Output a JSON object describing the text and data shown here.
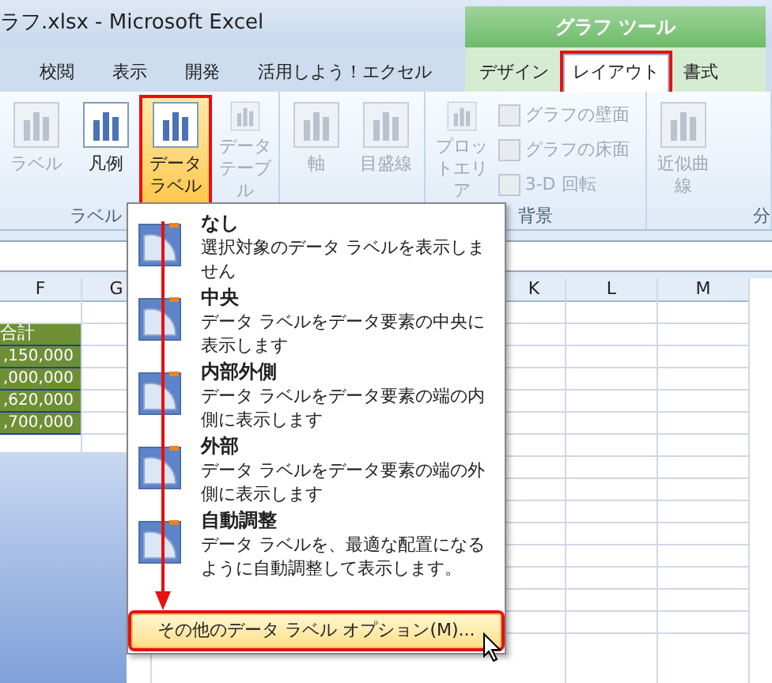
{
  "window": {
    "title": "ラフ.xlsx - Microsoft Excel",
    "context_group": "グラフ ツール"
  },
  "tabs": [
    {
      "label": "校閲",
      "selected": false
    },
    {
      "label": "表示",
      "selected": false
    },
    {
      "label": "開発",
      "selected": false
    },
    {
      "label": "活用しよう！エクセル",
      "selected": false
    }
  ],
  "context_tabs": [
    {
      "label": "デザイン",
      "selected": false
    },
    {
      "label": "レイアウト",
      "selected": true,
      "marked": true
    },
    {
      "label": "書式",
      "selected": false
    }
  ],
  "ribbon": {
    "groups": [
      {
        "label": "ラベル",
        "buttons": [
          {
            "kind": "large",
            "label": "ラベル",
            "disabled": true,
            "selected": false
          },
          {
            "kind": "large",
            "label": "凡例",
            "disabled": false,
            "selected": false
          },
          {
            "kind": "large",
            "label": "データラベル",
            "disabled": false,
            "selected": true,
            "marked": true
          },
          {
            "kind": "large",
            "label": "データテーブル",
            "disabled": true,
            "selected": false
          }
        ]
      },
      {
        "buttons": [
          {
            "kind": "large",
            "label": "軸",
            "disabled": true,
            "selected": false
          },
          {
            "kind": "large",
            "label": "目盛線",
            "disabled": true,
            "selected": false
          }
        ]
      },
      {
        "label": "背景",
        "buttons": [
          {
            "kind": "large",
            "label": "プロットエリア",
            "disabled": true,
            "selected": false
          },
          {
            "kind": "small",
            "label": "グラフの壁面",
            "disabled": true
          },
          {
            "kind": "small",
            "label": "グラフの床面",
            "disabled": true
          },
          {
            "kind": "small",
            "label": "3-D 回転",
            "disabled": true
          }
        ]
      },
      {
        "label": "分",
        "buttons": [
          {
            "kind": "large",
            "label": "近似曲線",
            "disabled": true,
            "selected": false
          }
        ]
      }
    ]
  },
  "sheet": {
    "columns_left": [
      "F",
      "G"
    ],
    "columns_right": [
      "K",
      "L",
      "M"
    ],
    "cells": [
      {
        "text": "合計",
        "kind": "header"
      },
      {
        "text": ",150,000",
        "kind": "value"
      },
      {
        "text": ",000,000",
        "kind": "value"
      },
      {
        "text": ",620,000",
        "kind": "value"
      },
      {
        "text": ",700,000",
        "kind": "value"
      }
    ]
  },
  "menu": {
    "items": [
      {
        "title": "なし",
        "description": "選択対象のデータ ラベルを表示しません",
        "selected": false
      },
      {
        "title": "中央",
        "description": "データ ラベルをデータ要素の中央に表示します",
        "selected": false
      },
      {
        "title": "内部外側",
        "description": "データ ラベルをデータ要素の端の内側に表示します",
        "selected": false
      },
      {
        "title": "外部",
        "description": "データ ラベルをデータ要素の端の外側に表示します",
        "selected": false
      },
      {
        "title": "自動調整",
        "description": "データ ラベルを、最適な配置になるように自動調整して表示します。",
        "selected": false
      }
    ],
    "footer": {
      "label": "その他のデータ ラベル オプション(M)...",
      "selected": true,
      "marked": true
    },
    "arrow": true
  }
}
